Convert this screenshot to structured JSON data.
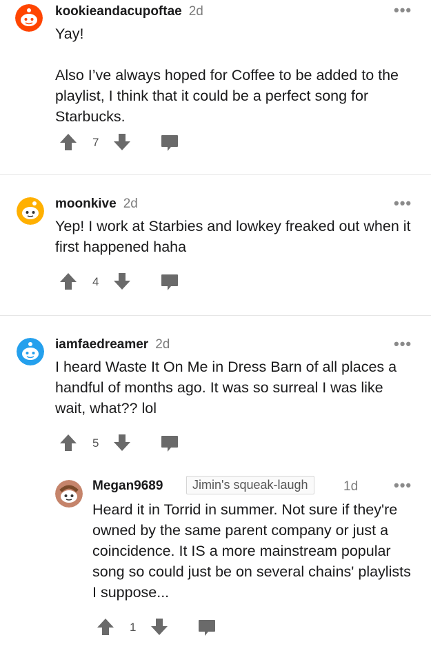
{
  "comments": [
    {
      "username": "kookieandacupoftae",
      "age": "2d",
      "paragraphs": [
        "Yay!",
        "Also I’ve always hoped for Coffee to be added to the playlist, I think that it could be a perfect song for Starbucks."
      ],
      "votes": "7",
      "avatar_color": "#ff4500"
    },
    {
      "username": "moonkive",
      "age": "2d",
      "paragraphs": [
        "Yep! I work at Starbies and lowkey freaked out when it first happened haha"
      ],
      "votes": "4",
      "avatar_color": "#ffb000"
    },
    {
      "username": "iamfaedreamer",
      "age": "2d",
      "paragraphs": [
        "I heard Waste It On Me in Dress Barn of all places a handful of months ago. It was so surreal I was like wait, what?? lol"
      ],
      "votes": "5",
      "avatar_color": "#24a0ed"
    },
    {
      "username": "Megan9689",
      "flair": "Jimin's squeak-laugh",
      "age": "1d",
      "paragraphs": [
        "Heard it in Torrid in summer. Not sure if they're owned by the same parent company or just a coincidence. It IS a more mainstream popular song so could just be on several chains' playlists I suppose..."
      ],
      "votes": "1",
      "avatar_color": "#c5846b"
    }
  ],
  "more_glyph": "•••",
  "icons": {
    "upvote": "upvote-icon",
    "downvote": "downvote-icon",
    "reply": "reply-icon",
    "more": "more-options-icon"
  },
  "colors": {
    "icon_gray": "#6a6a6a",
    "divider": "#e6e6e6"
  }
}
